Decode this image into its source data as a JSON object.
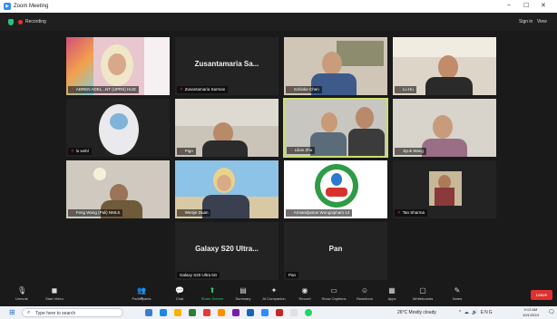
{
  "window": {
    "title": "Zoom Meeting",
    "minimize_icon": "minimize-icon",
    "maximize_icon": "maximize-icon",
    "close_icon": "close-icon"
  },
  "meeting_bar": {
    "recording_text": "Recording",
    "signin_text": "Sign in",
    "view_text": "View"
  },
  "tiles": [
    {
      "name": "ADREN ADEL...NT (UPRS) HUD"
    },
    {
      "name": "Zusantamaria Sarman",
      "big": "Zusantamaria Sa..."
    },
    {
      "name": "Schinke Chen"
    },
    {
      "name": "Lu Hu"
    },
    {
      "name": "lu webl"
    },
    {
      "name": "Pigo"
    },
    {
      "name": "Lilian Zhu"
    },
    {
      "name": "Jiyuk Wang"
    },
    {
      "name": "Feng Wang (Pali) NMLS"
    },
    {
      "name": "Wenjie Duan"
    },
    {
      "name": "Armandjustus Wungaipham 13"
    },
    {
      "name": "Tan Sharma"
    },
    {
      "name": "Galaxy S20 Ultra 5G",
      "big": "Galaxy S20 Ultra..."
    },
    {
      "name": "Pan",
      "big": "Pan"
    }
  ],
  "toolbar": {
    "unmute": "Unmute",
    "start_video": "Start Video",
    "participants": "Participants",
    "participants_count": "16",
    "chat": "Chat",
    "share_screen": "Share Screen",
    "summary": "Summary",
    "ai_companion": "AI Companion",
    "record": "Record",
    "show_captions": "Show Captions",
    "reactions": "Reactions",
    "apps": "Apps",
    "whiteboards": "Whiteboards",
    "notes": "Notes",
    "leave": "Leave"
  },
  "taskbar": {
    "search_placeholder": "Type here to search",
    "weather": "26°C  Mostly cloudy",
    "lang": "ENG",
    "time": "9:13 AM",
    "date": "10/1/2024"
  },
  "colors": {
    "share_green": "#2ecc71",
    "leave_red": "#e03030",
    "active_border": "#c9e06a",
    "zoom_blue": "#2d8cff"
  }
}
